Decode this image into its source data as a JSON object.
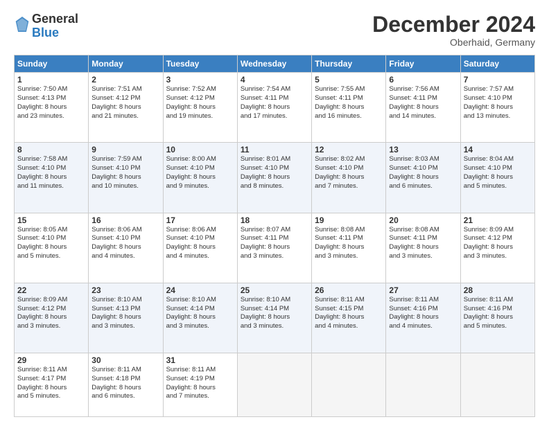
{
  "logo": {
    "general": "General",
    "blue": "Blue"
  },
  "header": {
    "month": "December 2024",
    "location": "Oberhaid, Germany"
  },
  "weekdays": [
    "Sunday",
    "Monday",
    "Tuesday",
    "Wednesday",
    "Thursday",
    "Friday",
    "Saturday"
  ],
  "weeks": [
    [
      {
        "day": "1",
        "lines": [
          "Sunrise: 7:50 AM",
          "Sunset: 4:13 PM",
          "Daylight: 8 hours",
          "and 23 minutes."
        ]
      },
      {
        "day": "2",
        "lines": [
          "Sunrise: 7:51 AM",
          "Sunset: 4:12 PM",
          "Daylight: 8 hours",
          "and 21 minutes."
        ]
      },
      {
        "day": "3",
        "lines": [
          "Sunrise: 7:52 AM",
          "Sunset: 4:12 PM",
          "Daylight: 8 hours",
          "and 19 minutes."
        ]
      },
      {
        "day": "4",
        "lines": [
          "Sunrise: 7:54 AM",
          "Sunset: 4:11 PM",
          "Daylight: 8 hours",
          "and 17 minutes."
        ]
      },
      {
        "day": "5",
        "lines": [
          "Sunrise: 7:55 AM",
          "Sunset: 4:11 PM",
          "Daylight: 8 hours",
          "and 16 minutes."
        ]
      },
      {
        "day": "6",
        "lines": [
          "Sunrise: 7:56 AM",
          "Sunset: 4:11 PM",
          "Daylight: 8 hours",
          "and 14 minutes."
        ]
      },
      {
        "day": "7",
        "lines": [
          "Sunrise: 7:57 AM",
          "Sunset: 4:10 PM",
          "Daylight: 8 hours",
          "and 13 minutes."
        ]
      }
    ],
    [
      {
        "day": "8",
        "lines": [
          "Sunrise: 7:58 AM",
          "Sunset: 4:10 PM",
          "Daylight: 8 hours",
          "and 11 minutes."
        ]
      },
      {
        "day": "9",
        "lines": [
          "Sunrise: 7:59 AM",
          "Sunset: 4:10 PM",
          "Daylight: 8 hours",
          "and 10 minutes."
        ]
      },
      {
        "day": "10",
        "lines": [
          "Sunrise: 8:00 AM",
          "Sunset: 4:10 PM",
          "Daylight: 8 hours",
          "and 9 minutes."
        ]
      },
      {
        "day": "11",
        "lines": [
          "Sunrise: 8:01 AM",
          "Sunset: 4:10 PM",
          "Daylight: 8 hours",
          "and 8 minutes."
        ]
      },
      {
        "day": "12",
        "lines": [
          "Sunrise: 8:02 AM",
          "Sunset: 4:10 PM",
          "Daylight: 8 hours",
          "and 7 minutes."
        ]
      },
      {
        "day": "13",
        "lines": [
          "Sunrise: 8:03 AM",
          "Sunset: 4:10 PM",
          "Daylight: 8 hours",
          "and 6 minutes."
        ]
      },
      {
        "day": "14",
        "lines": [
          "Sunrise: 8:04 AM",
          "Sunset: 4:10 PM",
          "Daylight: 8 hours",
          "and 5 minutes."
        ]
      }
    ],
    [
      {
        "day": "15",
        "lines": [
          "Sunrise: 8:05 AM",
          "Sunset: 4:10 PM",
          "Daylight: 8 hours",
          "and 5 minutes."
        ]
      },
      {
        "day": "16",
        "lines": [
          "Sunrise: 8:06 AM",
          "Sunset: 4:10 PM",
          "Daylight: 8 hours",
          "and 4 minutes."
        ]
      },
      {
        "day": "17",
        "lines": [
          "Sunrise: 8:06 AM",
          "Sunset: 4:10 PM",
          "Daylight: 8 hours",
          "and 4 minutes."
        ]
      },
      {
        "day": "18",
        "lines": [
          "Sunrise: 8:07 AM",
          "Sunset: 4:11 PM",
          "Daylight: 8 hours",
          "and 3 minutes."
        ]
      },
      {
        "day": "19",
        "lines": [
          "Sunrise: 8:08 AM",
          "Sunset: 4:11 PM",
          "Daylight: 8 hours",
          "and 3 minutes."
        ]
      },
      {
        "day": "20",
        "lines": [
          "Sunrise: 8:08 AM",
          "Sunset: 4:11 PM",
          "Daylight: 8 hours",
          "and 3 minutes."
        ]
      },
      {
        "day": "21",
        "lines": [
          "Sunrise: 8:09 AM",
          "Sunset: 4:12 PM",
          "Daylight: 8 hours",
          "and 3 minutes."
        ]
      }
    ],
    [
      {
        "day": "22",
        "lines": [
          "Sunrise: 8:09 AM",
          "Sunset: 4:12 PM",
          "Daylight: 8 hours",
          "and 3 minutes."
        ]
      },
      {
        "day": "23",
        "lines": [
          "Sunrise: 8:10 AM",
          "Sunset: 4:13 PM",
          "Daylight: 8 hours",
          "and 3 minutes."
        ]
      },
      {
        "day": "24",
        "lines": [
          "Sunrise: 8:10 AM",
          "Sunset: 4:14 PM",
          "Daylight: 8 hours",
          "and 3 minutes."
        ]
      },
      {
        "day": "25",
        "lines": [
          "Sunrise: 8:10 AM",
          "Sunset: 4:14 PM",
          "Daylight: 8 hours",
          "and 3 minutes."
        ]
      },
      {
        "day": "26",
        "lines": [
          "Sunrise: 8:11 AM",
          "Sunset: 4:15 PM",
          "Daylight: 8 hours",
          "and 4 minutes."
        ]
      },
      {
        "day": "27",
        "lines": [
          "Sunrise: 8:11 AM",
          "Sunset: 4:16 PM",
          "Daylight: 8 hours",
          "and 4 minutes."
        ]
      },
      {
        "day": "28",
        "lines": [
          "Sunrise: 8:11 AM",
          "Sunset: 4:16 PM",
          "Daylight: 8 hours",
          "and 5 minutes."
        ]
      }
    ],
    [
      {
        "day": "29",
        "lines": [
          "Sunrise: 8:11 AM",
          "Sunset: 4:17 PM",
          "Daylight: 8 hours",
          "and 5 minutes."
        ]
      },
      {
        "day": "30",
        "lines": [
          "Sunrise: 8:11 AM",
          "Sunset: 4:18 PM",
          "Daylight: 8 hours",
          "and 6 minutes."
        ]
      },
      {
        "day": "31",
        "lines": [
          "Sunrise: 8:11 AM",
          "Sunset: 4:19 PM",
          "Daylight: 8 hours",
          "and 7 minutes."
        ]
      },
      null,
      null,
      null,
      null
    ]
  ]
}
